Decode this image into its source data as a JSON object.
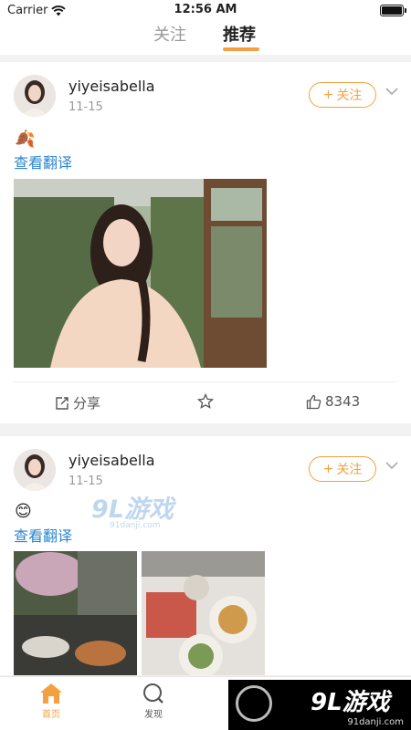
{
  "status": {
    "carrier": "Carrier",
    "time": "12:56 AM"
  },
  "topnav": {
    "follow": "关注",
    "recommend": "推荐"
  },
  "posts": [
    {
      "username": "yiyeisabella",
      "date": "11-15",
      "follow_label": "关注",
      "emoji": "🍂",
      "translate": "查看翻译",
      "share_label": "分享",
      "likes": "8343"
    },
    {
      "username": "yiyeisabella",
      "date": "11-15",
      "follow_label": "关注",
      "emoji": "😊",
      "translate": "查看翻译"
    }
  ],
  "tabbar": {
    "home": "首页",
    "discover": "发现"
  },
  "watermark": {
    "main": "9L游戏",
    "domain": "91danji.com"
  },
  "colors": {
    "accent": "#f5a040",
    "link": "#2d86d0"
  }
}
